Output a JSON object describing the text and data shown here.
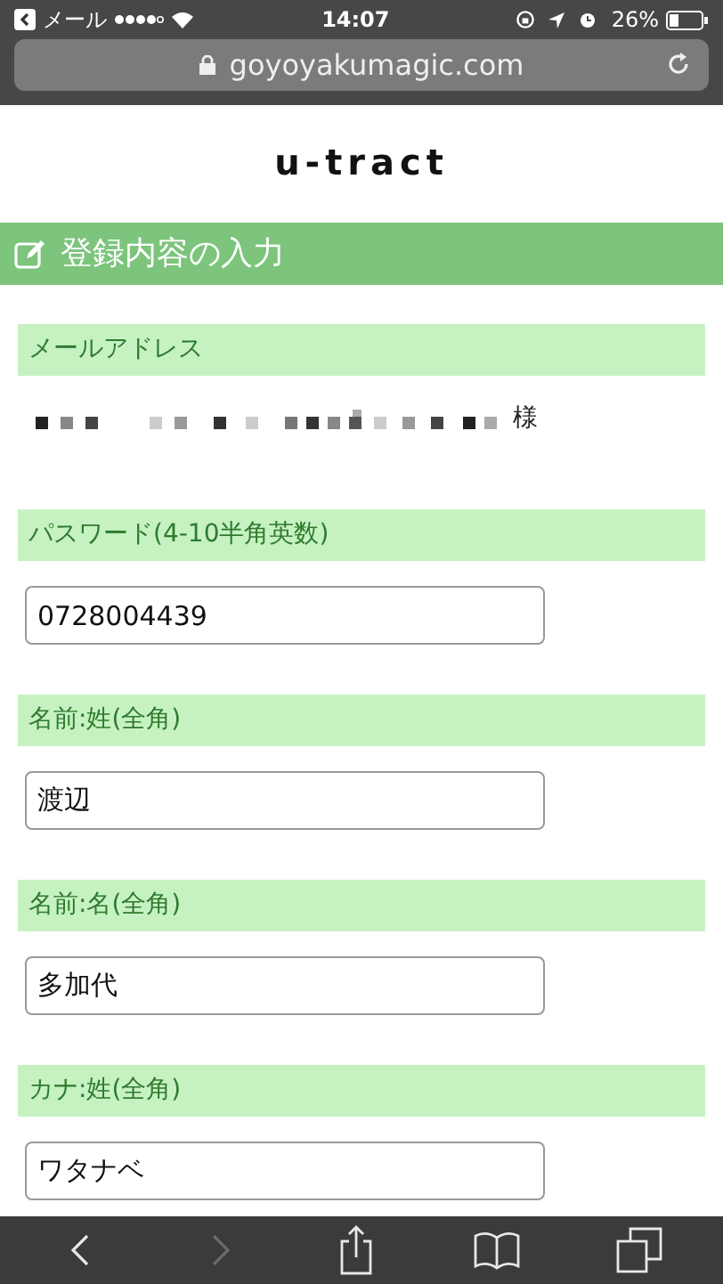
{
  "status_bar": {
    "back_label": "メール",
    "time": "14:07",
    "battery": "26%"
  },
  "address_bar": {
    "url": "goyoyakumagic.com"
  },
  "site_title": "u-tract",
  "section_title": "登録内容の入力",
  "fields": [
    {
      "kind": "static",
      "label": "メールアドレス",
      "suffix": "様"
    },
    {
      "kind": "input",
      "label": "パスワード(4-10半角英数)",
      "value": "0728004439"
    },
    {
      "kind": "input",
      "label": "名前:姓(全角)",
      "value": "渡辺"
    },
    {
      "kind": "input",
      "label": "名前:名(全角)",
      "value": "多加代"
    },
    {
      "kind": "input",
      "label": "カナ:姓(全角)",
      "value": "ワタナベ"
    }
  ],
  "toolbar": [
    {
      "kind": "back",
      "disabled": false
    },
    {
      "kind": "forward",
      "disabled": true
    },
    {
      "kind": "share",
      "disabled": false
    },
    {
      "kind": "bookmarks",
      "disabled": false
    },
    {
      "kind": "tabs",
      "disabled": false
    }
  ]
}
